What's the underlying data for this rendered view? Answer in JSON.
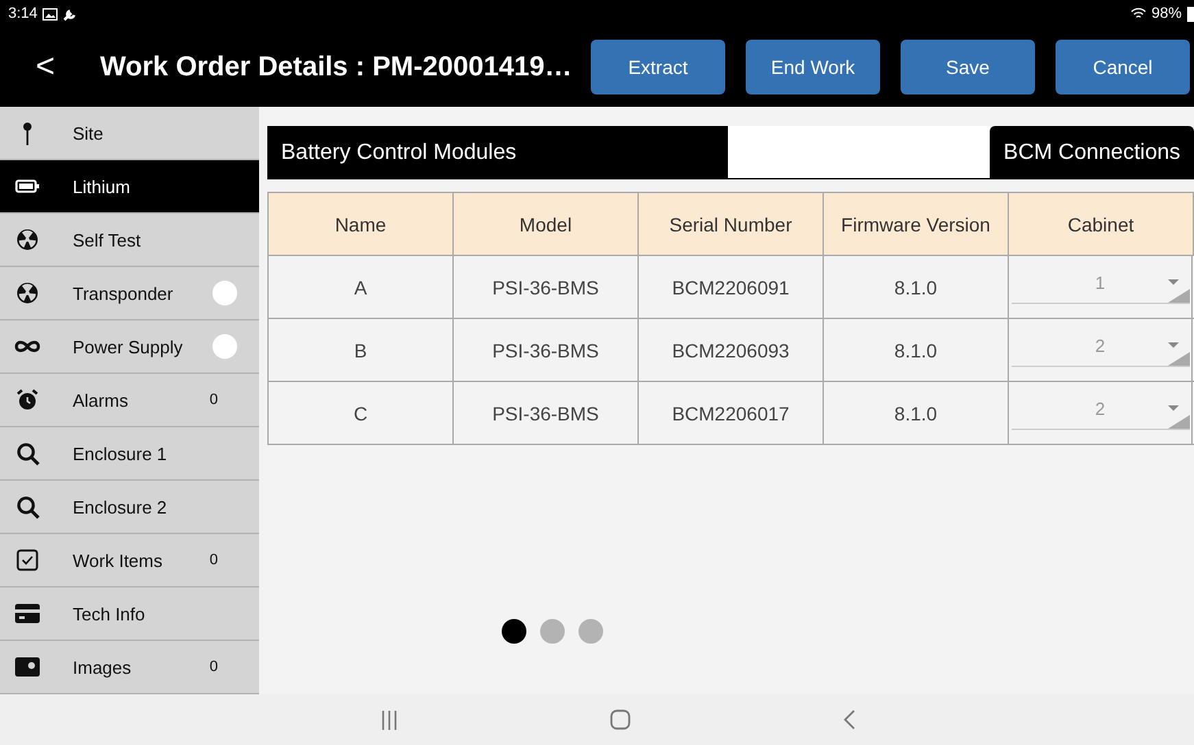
{
  "status_bar": {
    "time": "3:14",
    "battery": "98%"
  },
  "header": {
    "back": "<",
    "title": "Work Order Details : PM-20001419…",
    "buttons": [
      "Extract",
      "End Work",
      "Save",
      "Cancel"
    ]
  },
  "sidebar": {
    "items": [
      {
        "label": "Site",
        "selected": false
      },
      {
        "label": "Lithium",
        "selected": true
      },
      {
        "label": "Self Test",
        "selected": false
      },
      {
        "label": "Transponder",
        "selected": false,
        "kind": "dot"
      },
      {
        "label": "Power Supply",
        "selected": false,
        "kind": "dot"
      },
      {
        "label": "Alarms",
        "selected": false,
        "kind": "count",
        "count": "0"
      },
      {
        "label": "Enclosure 1",
        "selected": false
      },
      {
        "label": "Enclosure 2",
        "selected": false
      },
      {
        "label": "Work Items",
        "selected": false,
        "kind": "count",
        "count": "0"
      },
      {
        "label": "Tech Info",
        "selected": false
      },
      {
        "label": "Images",
        "selected": false,
        "kind": "count",
        "count": "0"
      }
    ]
  },
  "tabs": [
    {
      "label": "Battery Control Modules"
    },
    {
      "label": "BCM Connections"
    }
  ],
  "table": {
    "columns": [
      "Name",
      "Model",
      "Serial Number",
      "Firmware Version",
      "Cabinet"
    ],
    "rows": [
      {
        "name": "A",
        "model": "PSI-36-BMS",
        "serial": "BCM2206091",
        "firmware": "8.1.0",
        "cabinet": "1"
      },
      {
        "name": "B",
        "model": "PSI-36-BMS",
        "serial": "BCM2206093",
        "firmware": "8.1.0",
        "cabinet": "2"
      },
      {
        "name": "C",
        "model": "PSI-36-BMS",
        "serial": "BCM2206017",
        "firmware": "8.1.0",
        "cabinet": "2"
      }
    ]
  },
  "pager": [
    {
      "selected": true
    },
    {
      "selected": false
    },
    {
      "selected": false
    }
  ]
}
